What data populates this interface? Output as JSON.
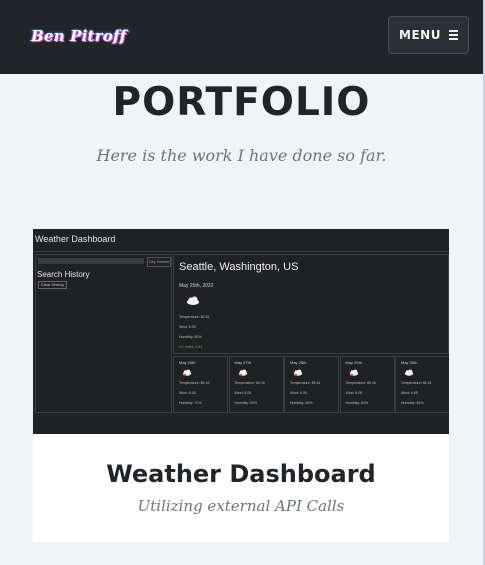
{
  "nav": {
    "brand": "Ben Pitroff",
    "menu_label": "MENU",
    "menu_icon": "hamburger-icon"
  },
  "portfolio": {
    "title": "PORTFOLIO",
    "subtitle": "Here is the work I have done so far."
  },
  "project": {
    "title": "Weather Dashboard",
    "subtitle": "Utilizing external API Calls",
    "preview": {
      "app_title": "Weather Dashboard",
      "search_button": "City Search",
      "search_history": "Search History",
      "clear_history": "Clear History",
      "city": "Seattle, Washington, US",
      "date": "May 25th, 2022",
      "current_icon": "cloud-icon",
      "temperature": "Temperature: 60.15",
      "wind": "Wind: 6.05",
      "humidity": "Humidity: 80%",
      "uv_index": "UV Index: 0.63",
      "forecast": [
        {
          "date": "May 26th",
          "temp": "Temperature: 85.16",
          "wind": "Wind: 6.05",
          "humidity": "Humidity: 70%",
          "icon": "rain-cloud-icon"
        },
        {
          "date": "May 27th",
          "temp": "Temperature: 86.16",
          "wind": "Wind: 6.05",
          "humidity": "Humidity: 90%",
          "icon": "rain-cloud-icon"
        },
        {
          "date": "May 28th",
          "temp": "Temperature: 85.16",
          "wind": "Wind: 6.05",
          "humidity": "Humidity: 85%",
          "icon": "rain-cloud-icon"
        },
        {
          "date": "May 29th",
          "temp": "Temperature: 85.16",
          "wind": "Wind: 6.05",
          "humidity": "Humidity: 83%",
          "icon": "rain-cloud-icon"
        },
        {
          "date": "May 30th",
          "temp": "Temperature: 85.16",
          "wind": "Wind: 6.05",
          "humidity": "Humidity: 84%",
          "icon": "cloud-icon"
        }
      ]
    }
  }
}
